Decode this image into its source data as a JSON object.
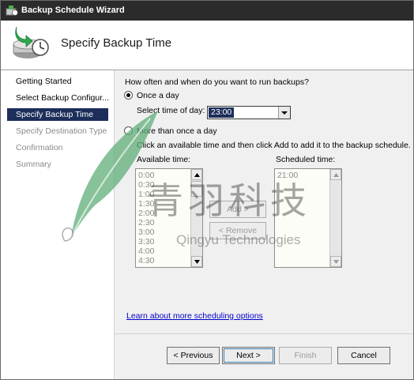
{
  "window": {
    "title": "Backup Schedule Wizard"
  },
  "header": {
    "title": "Specify Backup Time",
    "icon": "backup-clock-icon"
  },
  "nav": {
    "items": [
      {
        "label": "Getting Started",
        "state": "normal"
      },
      {
        "label": "Select Backup Configur...",
        "state": "normal"
      },
      {
        "label": "Specify Backup Time",
        "state": "active"
      },
      {
        "label": "Specify Destination Type",
        "state": "disabled"
      },
      {
        "label": "Confirmation",
        "state": "disabled"
      },
      {
        "label": "Summary",
        "state": "disabled"
      }
    ]
  },
  "content": {
    "question": "How often and when do you want to run backups?",
    "once_label": "Once a day",
    "time_label": "Select time of day:",
    "time_value": "23:00",
    "more_label": "More than once a day",
    "instruction": "Click an available time and then click Add to add it to the backup schedule.",
    "available_label": "Available time:",
    "available_times": [
      "0:00",
      "0:30",
      "1:00",
      "1:30",
      "2:00",
      "2:30",
      "3:00",
      "3:30",
      "4:00",
      "4:30"
    ],
    "scheduled_label": "Scheduled time:",
    "scheduled_times": [
      "21:00"
    ],
    "add_label": "Add >",
    "remove_label": "< Remove",
    "link": "Learn about more scheduling options"
  },
  "buttons": {
    "previous": "< Previous",
    "next": "Next >",
    "finish": "Finish",
    "cancel": "Cancel"
  },
  "watermark": {
    "title": "青羽科技",
    "subtitle": "Qingyu Technologies"
  },
  "colors": {
    "titlebar": "#2b2b2b",
    "selection": "#1c2e5a",
    "link": "#0000cc",
    "watermark_leaf": "#5fae7a"
  }
}
